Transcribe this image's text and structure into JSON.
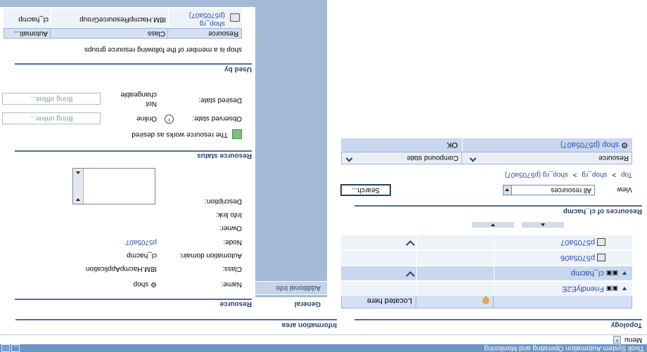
{
  "titlebar": {
    "title": "Tivoli System Automation Operating and Monitoring"
  },
  "menubar": {
    "menu_label": "Menu"
  },
  "topology": {
    "title": "Topology",
    "columns": {
      "located_here": "Located here"
    },
    "rows": [
      {
        "label": "FriendlyE2E",
        "expanded": false
      },
      {
        "label": "cl_hacmp",
        "expanded": true,
        "selected": true
      },
      {
        "label": "p5705a06"
      },
      {
        "label": "p5705a07"
      }
    ]
  },
  "resources": {
    "title": "Resources of cl_hacmp",
    "view_label": "View",
    "view_value": "All resources",
    "search_button": "Search...",
    "breadcrumb": {
      "top": "Top",
      "sep": ">",
      "crumb1": "shop_rg",
      "crumb2": "shop_rg (p5705a07)"
    },
    "columns": {
      "resource": "Resource",
      "compound_state": "Compound state"
    },
    "rows": [
      {
        "resource": "shop (p5705a07)",
        "state": "OK"
      }
    ]
  },
  "info_area": {
    "title": "Information area",
    "tabs": {
      "general": "General",
      "additional": "Additional Info"
    },
    "resource_title": "Resource",
    "fields": {
      "name_label": "Name:",
      "name_value": "shop",
      "class_label": "Class:",
      "class_value": "IBM.HacmpApplication",
      "domain_label": "Automation domain:",
      "domain_value": "cl_hacmp",
      "node_label": "Node:",
      "node_value": "p5705a07",
      "owner_label": "Owner:",
      "info_link_label": "Info link:",
      "description_label": "Description:"
    },
    "status_title": "Resource status",
    "status_line": "The resource works as desired",
    "observed_label": "Observed state:",
    "observed_value": "Online",
    "desired_label": "Desired state:",
    "desired_value_1": "Not",
    "desired_value_2": "changeable",
    "bring_online": "Bring online...",
    "bring_offline": "Bring offline...",
    "used_by_title": "Used by",
    "member_text": "shop is a member of the following resource groups",
    "groups_columns": {
      "resource": "Resource",
      "class": "Class",
      "automation": "Automati..."
    },
    "groups_rows": [
      {
        "resource_1": "shop_rg",
        "resource_2": "(p5705a07)",
        "class": "IBM.HacmpResourceGroup",
        "automation": "cl_hacmp"
      }
    ]
  },
  "colors": {
    "titlebar": "#6c94c4",
    "section_rule": "#4c6f9f",
    "row_bg": "#eef3fa",
    "row_selected": "#c9d7ef",
    "tab_panel": "#a3b9d6",
    "status_green": "#7fbf7f"
  }
}
